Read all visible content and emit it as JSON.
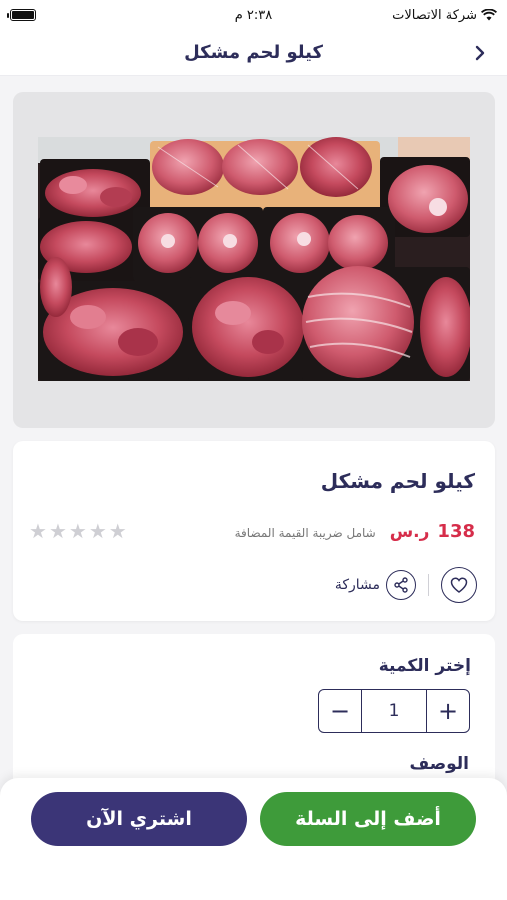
{
  "status_bar": {
    "carrier": "شركة الاتصالات",
    "time": "٢:٣٨ م"
  },
  "header": {
    "title": "كيلو لحم مشكل"
  },
  "product": {
    "title": "كيلو لحم مشكل",
    "price": "138",
    "currency": "ر.س",
    "vat_note": "شامل ضريبة القيمة المضافة",
    "rating": 0,
    "rating_max": 5,
    "share_label": "مشاركة"
  },
  "quantity": {
    "label": "إختر الكمية",
    "value": "1",
    "minus": "−",
    "plus": "+"
  },
  "description": {
    "label": "الوصف"
  },
  "actions": {
    "add_to_cart": "أضف إلى السلة",
    "buy_now": "اشتري الآن"
  },
  "colors": {
    "primary": "#2d2d5a",
    "price": "#d62d4a",
    "cart_button": "#3e9b3a",
    "buy_button": "#3b3577",
    "star_empty": "#cfcfd4"
  }
}
